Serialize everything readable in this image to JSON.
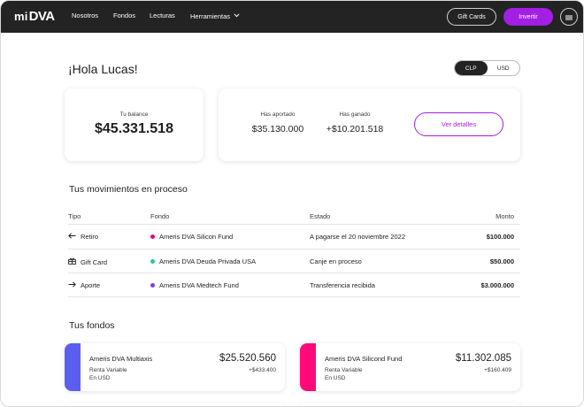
{
  "nav": {
    "logo_mi": "mi",
    "logo_dva": "DVA",
    "links": [
      "Nosotros",
      "Fondos",
      "Lecturas",
      "Herramientas"
    ],
    "gift_cards": "Gift Cards",
    "invest": "Invertir"
  },
  "greeting": "¡Hola Lucas!",
  "currency": {
    "options": [
      "CLP",
      "USD"
    ],
    "selected": "CLP"
  },
  "balance": {
    "label": "Tu balance",
    "value": "$45.331.518"
  },
  "summary": {
    "contributed_label": "Has aportado",
    "contributed_value": "$35.130.000",
    "earned_label": "Has ganado",
    "earned_value": "+$10.201.518",
    "details_button": "Ver detalles"
  },
  "movements": {
    "title": "Tus movimientos en proceso",
    "columns": {
      "type": "Tipo",
      "fund": "Fondo",
      "status": "Estado",
      "amount": "Monto"
    },
    "rows": [
      {
        "type": "Retiro",
        "icon": "arrow-left-icon",
        "fund": "Ameris DVA Silicon Fund",
        "fund_color": "#e6007e",
        "status": "A pagarse el 20 noviembre 2022",
        "amount": "$100.000"
      },
      {
        "type": "Gift Card",
        "icon": "gift-icon",
        "fund": "Ameris DVA Deuda Privada USA",
        "fund_color": "#19c9a4",
        "status": "Canje en proceso",
        "amount": "$50.000"
      },
      {
        "type": "Aporte",
        "icon": "arrow-right-icon",
        "fund": "Ameris DVA Medtech Fund",
        "fund_color": "#7b3fe4",
        "status": "Transferencia recibida",
        "amount": "$3.000.000"
      }
    ]
  },
  "funds": {
    "title": "Tus fondos",
    "items": [
      {
        "name": "Ameris DVA Multiaxis",
        "kind": "Renta Variable",
        "currency": "En USD",
        "value": "$25.520.560",
        "change": "+$433.400",
        "color": "#5b5ef0"
      },
      {
        "name": "Ameris DVA Silicond Fund",
        "kind": "Renta Variable",
        "currency": "En USD",
        "value": "$11.302.085",
        "change": "+$160.409",
        "color": "#ff0a78"
      }
    ]
  },
  "colors": {
    "accent": "#a21fe3",
    "nav_bg": "#232323"
  }
}
